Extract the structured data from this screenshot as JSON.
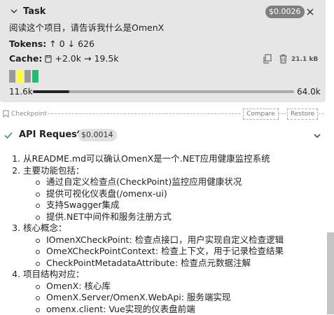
{
  "task": {
    "title": "Task",
    "cost": "$0.0026",
    "text": "阅读这个项目，请告诉我什么是OmenX",
    "tokens_label": "Tokens:",
    "tokens_in": "↑ 0",
    "tokens_out": "↓ 626",
    "cache_label": "Cache:",
    "cache_write": "+2.0k",
    "cache_read": "→ 19.5k",
    "size": "21.1 kB",
    "context_start": "11.6k",
    "context_end": "64.0k",
    "context_fraction": 0.14,
    "block_colors": [
      "#999999",
      "#ffff33",
      "#999999",
      "#22bb77"
    ]
  },
  "checkpoint": {
    "label": "Checkpoint",
    "compare": "Compare",
    "restore": "Restore"
  },
  "api_request": {
    "title": "API Request",
    "cost": "$0.0014",
    "status_color": "#2e9b46"
  },
  "answer": {
    "items": [
      {
        "text": "从README.md可以确认OmenX是一个.NET应用健康监控系统",
        "subitems": []
      },
      {
        "text": "主要功能包括：",
        "subitems": [
          "通过自定义检查点(CheckPoint)监控应用健康状况",
          "提供可视化仪表盘(/omenx-ui)",
          "支持Swagger集成",
          "提供.NET中间件和服务注册方式"
        ]
      },
      {
        "text": "核心概念：",
        "subitems": [
          "IOmenXCheckPoint: 检查点接口，用户实现自定义检查逻辑",
          "OmeXCheckPointContext: 检查上下文，用于记录检查结果",
          "CheckPointMetadataAttribute: 检查点元数据注解"
        ]
      },
      {
        "text": "项目结构对应：",
        "subitems": [
          "OmenX: 核心库",
          "OmenX.Server/OmenX.WebApi: 服务端实现",
          "omenx.client: Vue实现的仪表盘前端"
        ]
      }
    ]
  }
}
